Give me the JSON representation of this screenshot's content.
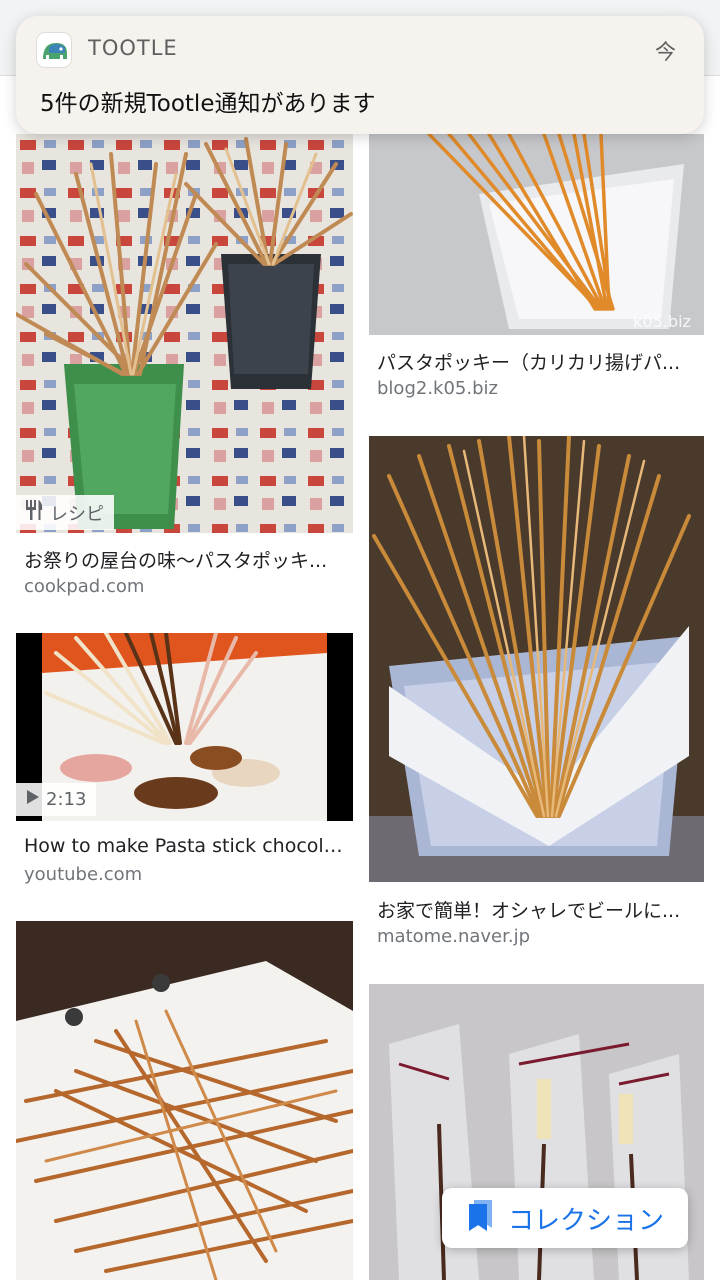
{
  "notification": {
    "app_name": "TOOTLE",
    "time": "今",
    "message": "5件の新規Tootle通知があります"
  },
  "results": [
    {
      "caption": "お祭りの屋台の味〜パスタポッキ...",
      "source": "cookpad.com",
      "badge": "レシピ",
      "badge_icon": "utensils-icon"
    },
    {
      "caption": "パスタポッキー（カリカリ揚げパ...",
      "source": "blog2.k05.biz",
      "watermark": "k05.biz"
    },
    {
      "caption": "How to make Pasta stick chocola...",
      "source": "youtube.com",
      "badge": "2:13",
      "badge_icon": "play-icon"
    },
    {
      "caption": "お家で簡単！オシャレでビールに...",
      "source": "matome.naver.jp"
    }
  ],
  "collection_button": {
    "label": "コレクション",
    "icon": "bookmark-icon"
  },
  "colors": {
    "accent": "#1a73e8",
    "source_text": "#70757a"
  }
}
